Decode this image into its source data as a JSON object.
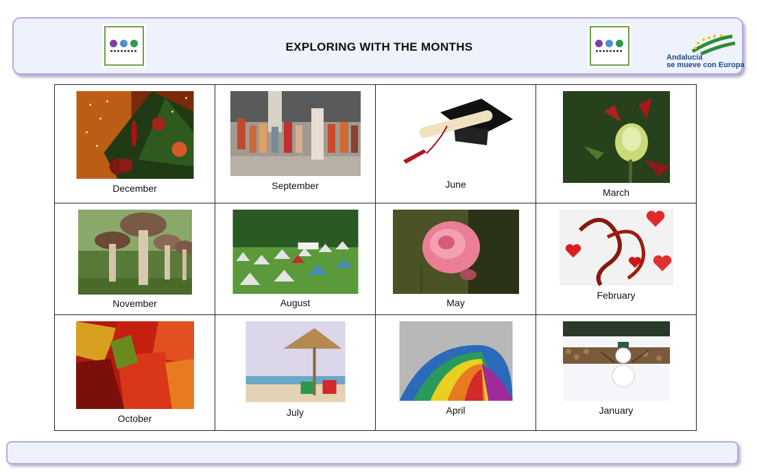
{
  "header": {
    "title": "EXPLORING WITH THE MONTHS",
    "left_logo_icon": "school-project-logo",
    "right_logo_icon": "school-project-logo",
    "eu_logo": {
      "icon": "andalucia-europa-logo",
      "line1": "Andalucía",
      "line2": "se mueve con Europa"
    }
  },
  "grid": {
    "rows": [
      [
        {
          "month": "December",
          "picture": "christmas-tree-ornaments"
        },
        {
          "month": "September",
          "picture": "schoolchildren-in-street"
        },
        {
          "month": "June",
          "picture": "graduation-cap-diploma"
        },
        {
          "month": "March",
          "picture": "rosebud"
        }
      ],
      [
        {
          "month": "November",
          "picture": "mushrooms"
        },
        {
          "month": "August",
          "picture": "camping-tents"
        },
        {
          "month": "May",
          "picture": "pink-rose"
        },
        {
          "month": "February",
          "picture": "valentine-ribbon-hearts"
        }
      ],
      [
        {
          "month": "October",
          "picture": "autumn-maple-leaves"
        },
        {
          "month": "July",
          "picture": "beach-umbrella-chairs"
        },
        {
          "month": "April",
          "picture": "rainbow-umbrella"
        },
        {
          "month": "January",
          "picture": "snowman"
        }
      ]
    ]
  },
  "colors": {
    "banner_fill": "#eef2fc",
    "banner_border": "#b7a8e2",
    "grid_border": "#222222"
  }
}
